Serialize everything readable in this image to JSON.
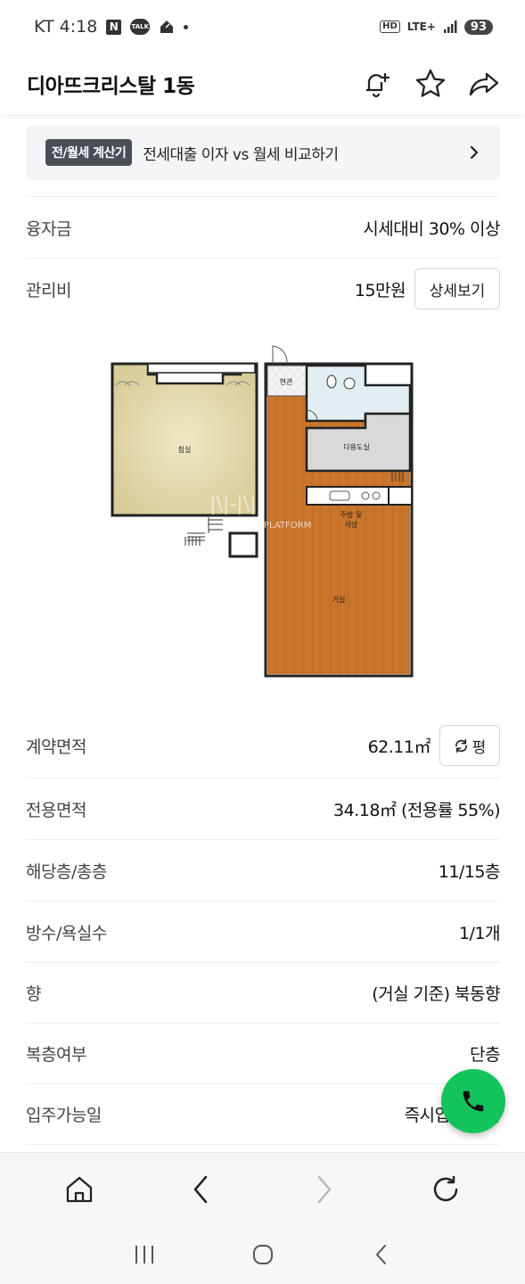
{
  "status_bar": {
    "carrier_time": "KT 4:18",
    "n_badge": "N",
    "talk_badge": "TALK",
    "hd_label": "HD",
    "lte_label": "LTE+",
    "battery": "93"
  },
  "header": {
    "title": "디아뜨크리스탈 1동"
  },
  "calc_banner": {
    "tag": "전/월세 계산기",
    "text": "전세대출 이자 vs 월세 비교하기"
  },
  "rows": {
    "loan": {
      "label": "융자금",
      "value": "시세대비 30% 이상"
    },
    "maintenance": {
      "label": "관리비",
      "value": "15만원",
      "button": "상세보기"
    },
    "contract_area": {
      "label": "계약면적",
      "value": "62.11㎡",
      "button": "평"
    },
    "exclusive_area": {
      "label": "전용면적",
      "value": "34.18㎡ (전용률 55%)"
    },
    "floor": {
      "label": "해당층/총층",
      "value": "11/15층"
    },
    "rooms": {
      "label": "방수/욕실수",
      "value": "1/1개"
    },
    "direction": {
      "label": "향",
      "value": "(거실 기준) 북동향"
    },
    "duplex": {
      "label": "복층여부",
      "value": "단층"
    },
    "move_in": {
      "label": "입주가능일",
      "value": "즉시입주 협의"
    }
  },
  "floorplan": {
    "entrance": "현관",
    "bedroom": "침실",
    "utility": "다용도실",
    "kitchen_line1": "주방 및",
    "kitchen_line2": "식당",
    "living": "거실",
    "watermark": "PLATFORM"
  },
  "colors": {
    "call_green": "#12c45a",
    "wood_floor": "#c8742a",
    "bedroom_floor": "#e9dfb7",
    "tag_bg": "#4a4f57"
  }
}
